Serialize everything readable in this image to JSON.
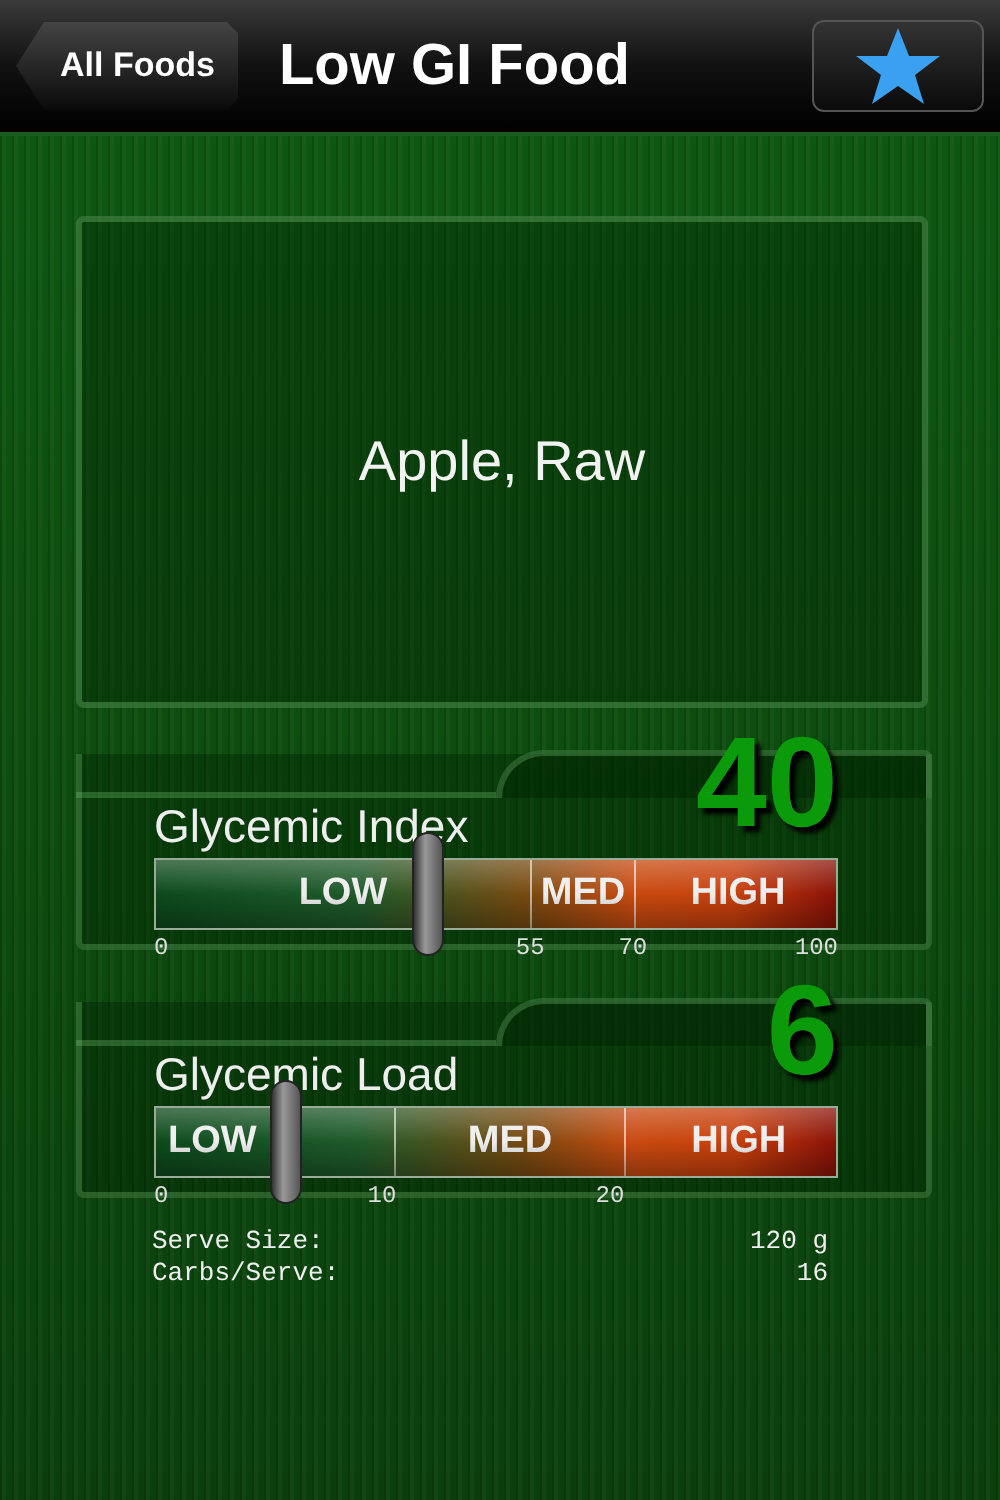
{
  "nav_bar": {
    "back_button": "All Foods",
    "title": "Low GI Food"
  },
  "food": {
    "name": "Apple, Raw"
  },
  "gauges": [
    {
      "label": "Glycemic Index",
      "value": "40",
      "level": 0.4,
      "segments": [
        "LOW",
        "MED",
        "HIGH"
      ],
      "ticks": [
        "0",
        "55",
        "70",
        "100"
      ]
    },
    {
      "label": "Glycemic Load",
      "value": "6",
      "level": 0.19,
      "segments": [
        "LOW",
        "MED",
        "HIGH"
      ],
      "ticks": [
        "0",
        "10",
        "20"
      ]
    }
  ],
  "details": [
    {
      "label": "Serve Size:",
      "value": "120 g"
    },
    {
      "label": "Carbs/Serve:",
      "value": "16"
    }
  ]
}
